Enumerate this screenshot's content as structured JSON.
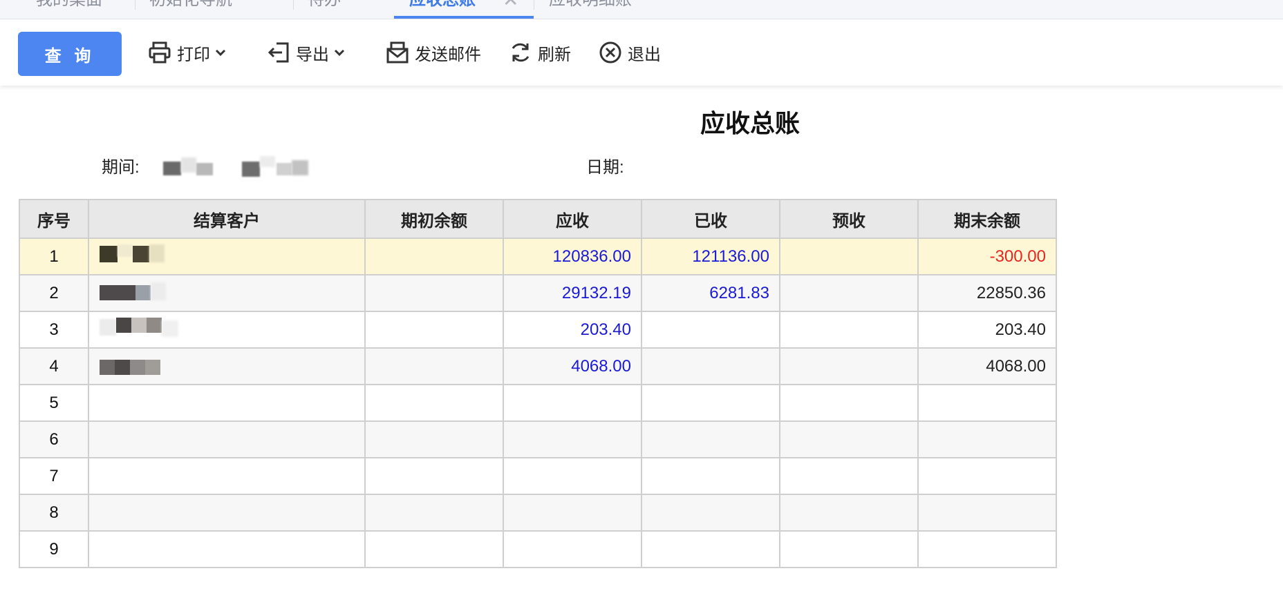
{
  "tabs": [
    {
      "label": "我的桌面"
    },
    {
      "label": "初始化导航"
    },
    {
      "label": "待办"
    },
    {
      "label": "应收总账",
      "active": true
    },
    {
      "label": "应收明细账"
    }
  ],
  "toolbar": {
    "query_label": "查 询",
    "print_label": "打印",
    "export_label": "导出",
    "email_label": "发送邮件",
    "refresh_label": "刷新",
    "exit_label": "退出"
  },
  "report": {
    "title": "应收总账",
    "period_label": "期间:",
    "date_label": "日期:"
  },
  "table": {
    "headers": [
      "序号",
      "结算客户",
      "期初余额",
      "应收",
      "已收",
      "预收",
      "期末余额"
    ],
    "rows": [
      {
        "seq": "1",
        "customer": "",
        "opening": "",
        "receivable": "120836.00",
        "received": "121136.00",
        "prepaid": "",
        "closing": "-300.00"
      },
      {
        "seq": "2",
        "customer": "",
        "opening": "",
        "receivable": "29132.19",
        "received": "6281.83",
        "prepaid": "",
        "closing": "22850.36"
      },
      {
        "seq": "3",
        "customer": "",
        "opening": "",
        "receivable": "203.40",
        "received": "",
        "prepaid": "",
        "closing": "203.40"
      },
      {
        "seq": "4",
        "customer": "",
        "opening": "",
        "receivable": "4068.00",
        "received": "",
        "prepaid": "",
        "closing": "4068.00"
      },
      {
        "seq": "5",
        "customer": "",
        "opening": "",
        "receivable": "",
        "received": "",
        "prepaid": "",
        "closing": ""
      },
      {
        "seq": "6",
        "customer": "",
        "opening": "",
        "receivable": "",
        "received": "",
        "prepaid": "",
        "closing": ""
      },
      {
        "seq": "7",
        "customer": "",
        "opening": "",
        "receivable": "",
        "received": "",
        "prepaid": "",
        "closing": ""
      },
      {
        "seq": "8",
        "customer": "",
        "opening": "",
        "receivable": "",
        "received": "",
        "prepaid": "",
        "closing": ""
      },
      {
        "seq": "9",
        "customer": "",
        "opening": "",
        "receivable": "",
        "received": "",
        "prepaid": "",
        "closing": ""
      }
    ]
  },
  "colors": {
    "accent": "#4d86f0",
    "amount_blue": "#1a1ad6",
    "negative_red": "#e6261f",
    "selected_row": "#fef7d6",
    "header_bg": "#e8e8e8"
  },
  "icons": [
    "printer-icon",
    "export-icon",
    "email-icon",
    "refresh-icon",
    "close-circle-icon",
    "chevron-down-icon"
  ]
}
